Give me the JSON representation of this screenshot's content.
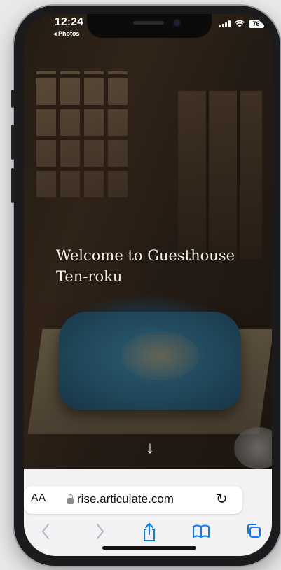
{
  "status_bar": {
    "time": "12:24",
    "back_link": "◂ Photos",
    "battery": "76"
  },
  "page": {
    "heading": "Welcome to Guesthouse Ten-roku"
  },
  "browser": {
    "text_size_label": "AA",
    "url": "rise.articulate.com"
  },
  "colors": {
    "accent": "#0a7aff",
    "toolbar_bg": "#f2f2f4"
  },
  "icons": {
    "scroll": "arrow-down-icon",
    "back": "chevron-left-icon",
    "forward": "chevron-right-icon",
    "share": "share-icon",
    "bookmarks": "book-icon",
    "tabs": "tabs-icon",
    "reload": "reload-icon"
  }
}
